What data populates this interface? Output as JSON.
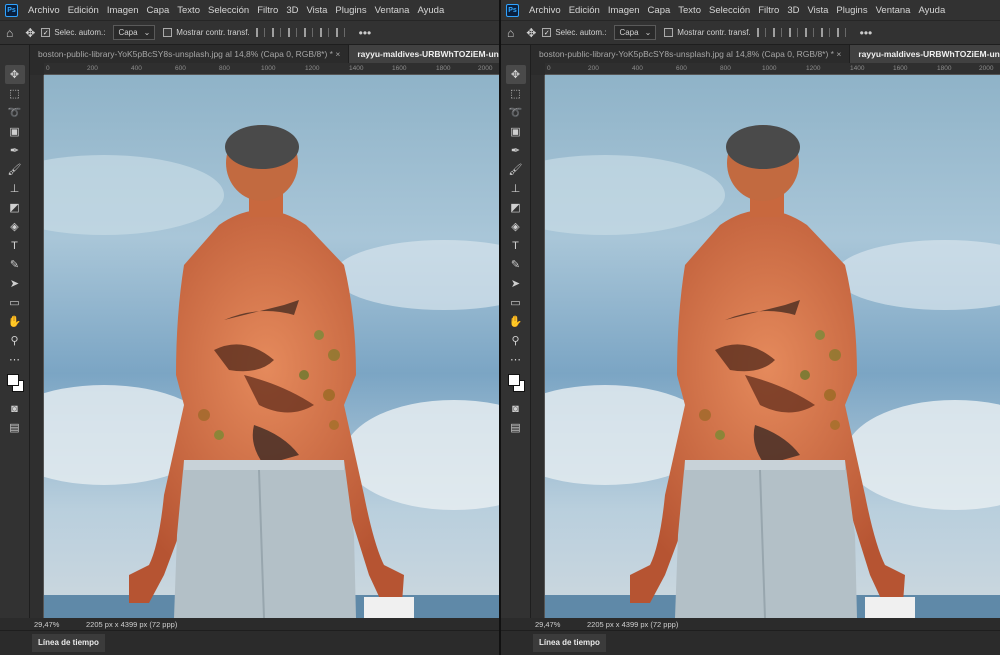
{
  "menu": [
    "Archivo",
    "Edición",
    "Imagen",
    "Capa",
    "Texto",
    "Selección",
    "Filtro",
    "3D",
    "Vista",
    "Plugins",
    "Ventana",
    "Ayuda"
  ],
  "app_logo": "Ps",
  "options": {
    "auto_select_label": "Selec. autom.:",
    "auto_select_value": "Capa",
    "show_transform_label": "Mostrar contr. transf.",
    "more": "•••"
  },
  "tabs": [
    {
      "label": "boston-public-library-YoK5pBcSY8s-unsplash.jpg al 14,8% (Capa 0, RGB/8*) *",
      "close": "×"
    },
    {
      "label": "rayyu-maldives-URBWhTOZiEM-unsplash.jpg",
      "close": "×"
    }
  ],
  "ruler_ticks": [
    "0",
    "200",
    "400",
    "600",
    "800",
    "1000",
    "1200",
    "1400",
    "1600",
    "1800",
    "2000"
  ],
  "status": {
    "zoom": "29,47%",
    "dimensions": "2205 px x 4399 px (72 ppp)"
  },
  "timeline_label": "Línea de tiempo",
  "tool_icons": [
    "move-icon",
    "marquee-icon",
    "lasso-icon",
    "object-select-icon",
    "eyedropper-icon",
    "brush-icon",
    "stamp-icon",
    "eraser-icon",
    "paint-bucket-icon",
    "type-icon",
    "pen-icon",
    "path-select-icon",
    "rectangle-icon",
    "hand-icon",
    "zoom-icon",
    "more-tools-icon"
  ]
}
